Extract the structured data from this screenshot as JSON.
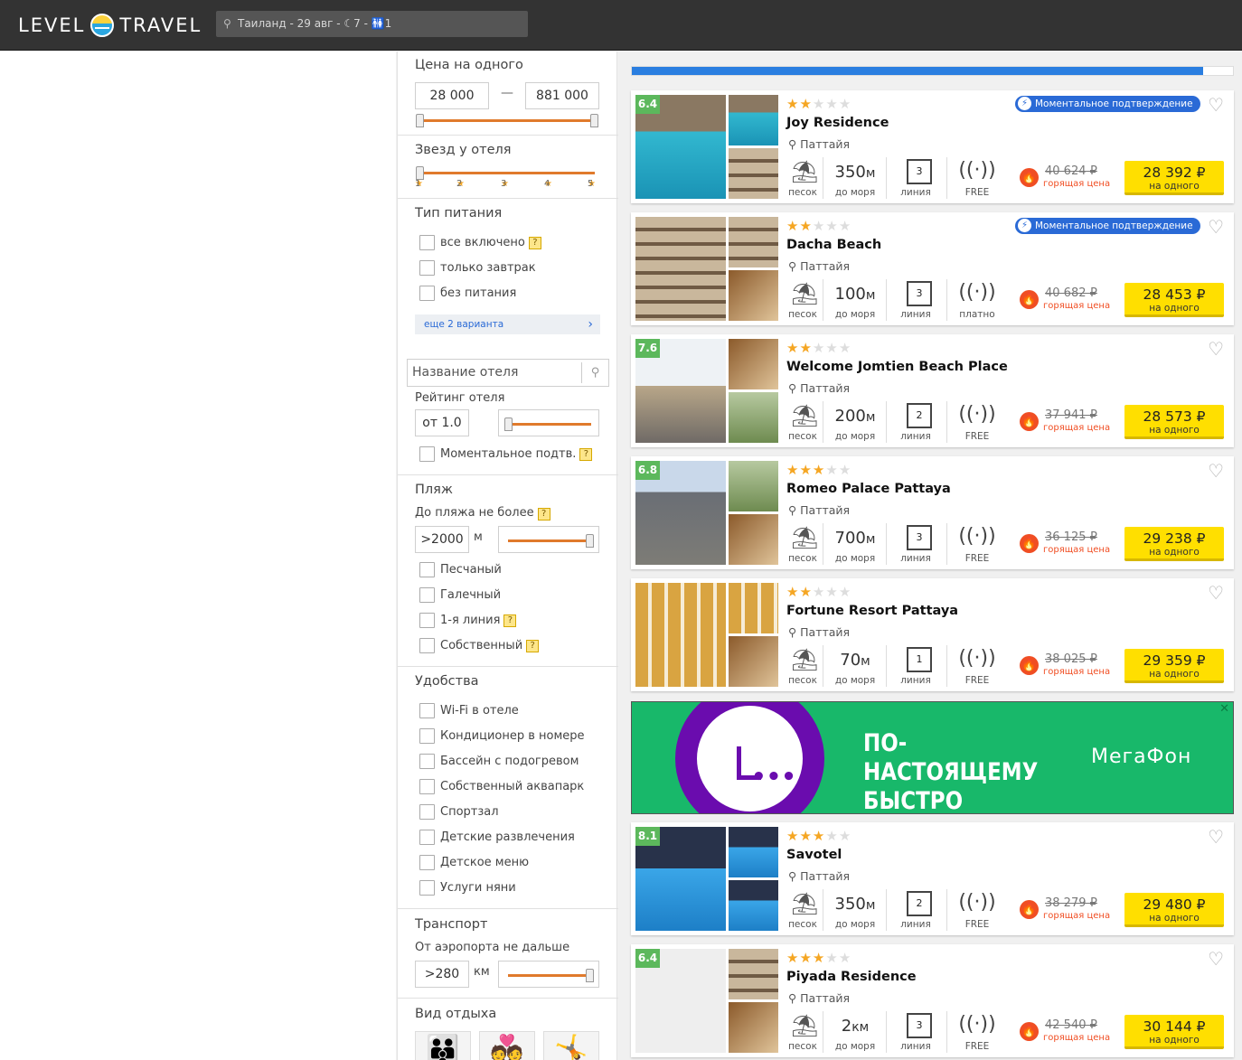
{
  "header": {
    "logo_left": "LEVEL",
    "logo_right": "TRAVEL",
    "search_text": "Таиланд - 29 авг - ☾7 - 🚻1"
  },
  "progress": {
    "fraction": 0.95
  },
  "filters": {
    "price": {
      "title": "Цена на одного",
      "min": "28 000",
      "dash": "—",
      "max": "881 000"
    },
    "stars": {
      "title": "Звезд у отеля",
      "ticks": [
        "1",
        "2",
        "3",
        "4",
        "5"
      ],
      "star": "★"
    },
    "meal": {
      "title": "Тип питания",
      "options": [
        {
          "label": "все включено",
          "help": true
        },
        {
          "label": "только завтрак",
          "help": false
        },
        {
          "label": "без питания",
          "help": false
        }
      ],
      "more": "еще 2 варианта"
    },
    "name": {
      "placeholder": "Название отеля",
      "rating_label": "Рейтинг отеля",
      "rating_from": "от 1.0",
      "instant": "Моментальное подтв."
    },
    "beach": {
      "title": "Пляж",
      "distance_label": "До пляжа не более",
      "distance_value": ">2000",
      "unit": "м",
      "options": [
        {
          "label": "Песчаный",
          "help": false
        },
        {
          "label": "Галечный",
          "help": false
        },
        {
          "label": "1-я линия",
          "help": true
        },
        {
          "label": "Собственный",
          "help": true
        }
      ]
    },
    "amenities": {
      "title": "Удобства",
      "options": [
        "Wi-Fi в отеле",
        "Кондиционер в номере",
        "Бассейн с подогревом",
        "Собственный аквапарк",
        "Спортзал",
        "Детские развлечения",
        "Детское меню",
        "Услуги няни"
      ]
    },
    "transport": {
      "title": "Транспорт",
      "label": "От аэропорта не дальше",
      "value": ">280",
      "unit": "км"
    },
    "rest": {
      "title": "Вид отдыха"
    }
  },
  "common": {
    "city": "Паттайя",
    "beach_label": "песок",
    "to_sea": "до моря",
    "line_label": "линия",
    "hot_label": "горящая цена",
    "per_person": "на одного",
    "instant_badge": "Моментальное подтверждение"
  },
  "hotels": [
    {
      "rating": "6.4",
      "stars": 2,
      "name": "Joy Residence",
      "instant": true,
      "dist_num": "350",
      "dist_unit": "м",
      "line": "3",
      "wifi": "FREE",
      "old_price": "40 624 ₽",
      "price": "28 392 ₽",
      "photos": [
        "pool",
        "pool",
        "bldg"
      ]
    },
    {
      "rating": "",
      "stars": 2,
      "name": "Dacha Beach",
      "instant": true,
      "dist_num": "100",
      "dist_unit": "м",
      "line": "3",
      "wifi": "платно",
      "old_price": "40 682 ₽",
      "price": "28 453 ₽",
      "photos": [
        "bldg",
        "bldg",
        "interior"
      ]
    },
    {
      "rating": "7.6",
      "stars": 2,
      "name": "Welcome Jomtien Beach Place",
      "instant": false,
      "dist_num": "200",
      "dist_unit": "м",
      "line": "2",
      "wifi": "FREE",
      "old_price": "37 941 ₽",
      "price": "28 573 ₽",
      "photos": [
        "street",
        "interior",
        "green"
      ]
    },
    {
      "rating": "6.8",
      "stars": 3,
      "name": "Romeo Palace Pattaya",
      "instant": false,
      "dist_num": "700",
      "dist_unit": "м",
      "line": "3",
      "wifi": "FREE",
      "old_price": "36 125 ₽",
      "price": "29 238 ₽",
      "photos": [
        "hotelfront",
        "green",
        "interior"
      ]
    },
    {
      "rating": "",
      "stars": 2,
      "name": "Fortune Resort Pattaya",
      "instant": false,
      "dist_num": "70",
      "dist_unit": "м",
      "line": "1",
      "wifi": "FREE",
      "old_price": "38 025 ₽",
      "price": "29 359 ₽",
      "photos": [
        "yellowb",
        "yellowb",
        "interior"
      ]
    },
    {
      "rating": "8.1",
      "stars": 3,
      "name": "Savotel",
      "instant": false,
      "dist_num": "350",
      "dist_unit": "м",
      "line": "2",
      "wifi": "FREE",
      "old_price": "38 279 ₽",
      "price": "29 480 ₽",
      "photos": [
        "bluepool",
        "bluepool",
        "bluepool"
      ]
    },
    {
      "rating": "6.4",
      "stars": 3,
      "name": "Piyada Residence",
      "instant": false,
      "dist_num": "2",
      "dist_unit": "км",
      "line": "3",
      "wifi": "FREE",
      "old_price": "42 540 ₽",
      "price": "30 144 ₽",
      "photos": [
        "grey",
        "bldg",
        "interior"
      ]
    }
  ],
  "ad": {
    "slogan": "ПО-НАСТОЯЩЕМУ БЫСТРО",
    "brand": "МегаФон",
    "close": "✕"
  }
}
